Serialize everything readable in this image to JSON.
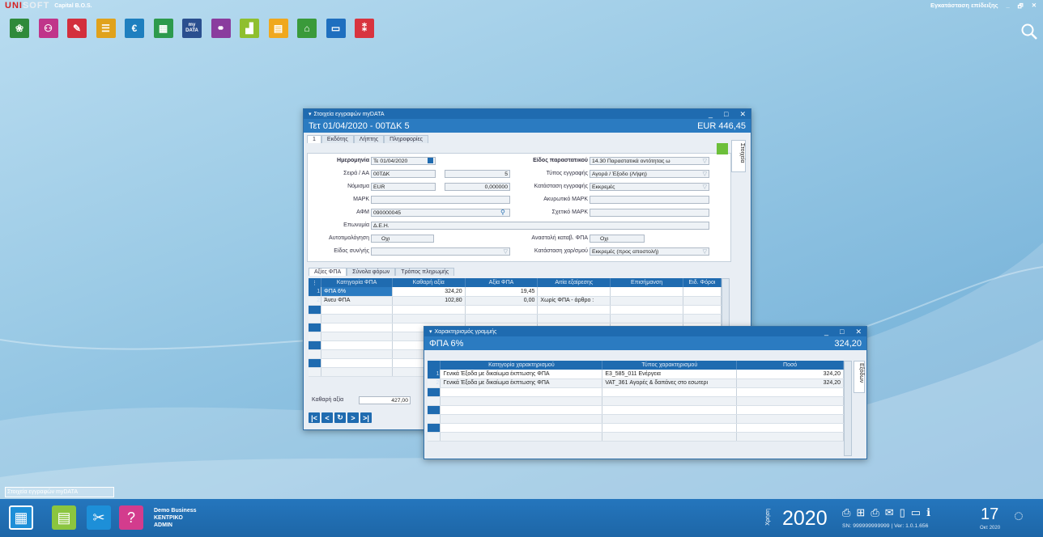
{
  "app": {
    "logo_red": "UNI",
    "logo_rest": "SOFT",
    "caption": "Capital B.O.S."
  },
  "top_right": {
    "install_label": "Εγκατάσταση επίδειξης",
    "min": "_",
    "restore": "🗗",
    "close": "✕"
  },
  "app_icons": [
    {
      "name": "app-1-icon",
      "color": "#2f8a3a",
      "glyph": "❀"
    },
    {
      "name": "app-2-icon",
      "color": "#c0358a",
      "glyph": "⚇"
    },
    {
      "name": "app-3-icon",
      "color": "#d32f3d",
      "glyph": "✎"
    },
    {
      "name": "app-4-icon",
      "color": "#e0a21c",
      "glyph": "☰"
    },
    {
      "name": "app-5-icon",
      "color": "#1e7fbf",
      "glyph": "€"
    },
    {
      "name": "app-6-icon",
      "color": "#2d9a4d",
      "glyph": "▦"
    },
    {
      "name": "app-7-icon",
      "color": "#2a4f8f",
      "glyph": "my DATA"
    },
    {
      "name": "app-8-icon",
      "color": "#8a3c9e",
      "glyph": "⚭"
    },
    {
      "name": "app-9-icon",
      "color": "#8fbf2f",
      "glyph": "▟"
    },
    {
      "name": "app-10-icon",
      "color": "#f0a81e",
      "glyph": "▤"
    },
    {
      "name": "app-11-icon",
      "color": "#3a9a3a",
      "glyph": "⌂"
    },
    {
      "name": "app-12-icon",
      "color": "#1e6fbf",
      "glyph": "▭"
    },
    {
      "name": "app-13-icon",
      "color": "#d8343f",
      "glyph": "⁑"
    }
  ],
  "doc_window": {
    "title": "Στοιχεία εγγραφών myDATA",
    "header_left": "Τετ 01/04/2020 - 00ΤΔΚ 5",
    "header_right": "EUR 446,45",
    "tabs": [
      "1",
      "Εκδότης",
      "Λήπτης",
      "Πληροφορίες"
    ],
    "side_tab": "Στοιχεία",
    "fields": {
      "date_label": "Ημερομηνία",
      "date_value": "Τε 01/04/2020",
      "series_label": "Σειρά / ΑΑ",
      "series_value": "00ΤΔΚ",
      "aa_value": "5",
      "currency_label": "Νόμισμα",
      "currency_value": "EUR",
      "rate_value": "0,000000",
      "mark_label": "ΜΑΡΚ",
      "mark_value": "",
      "afm_label": "ΑΦΜ",
      "afm_value": "090000045",
      "name_label": "Επωνυμία",
      "name_value": "Δ.Ε.Η.",
      "selfinv_label": "Αυτοτιμολόγηση",
      "selfinv_value": "Οχι",
      "kind_label": "Είδος συν/γής",
      "kind_value": "",
      "doctype_label": "Είδος παραστατικού",
      "doctype_value": "14.30 Παραστατικά οντότητας ω",
      "rectype_label": "Τύπος εγγραφής",
      "rectype_value": "Αγορά / Έξοδο (Λήψη)",
      "recstate_label": "Κατάσταση εγγραφής",
      "recstate_value": "Εκκρεμές",
      "cancelmark_label": "Ακυρωτικό ΜΑΡΚ",
      "cancelmark_value": "",
      "relmark_label": "Σχετικό ΜΑΡΚ",
      "relmark_value": "",
      "vatsusp_label": "Αναστολή καταβ. ΦΠΑ",
      "vatsusp_value": "Οχι",
      "charstate_label": "Κατάσταση χαρ/σμού",
      "charstate_value": "Εκκρεμές (προς αποστολή)"
    },
    "grid_tabs": [
      "Αξίες ΦΠΑ",
      "Σύνολα φόρων",
      "Τρόπος πληρωμής"
    ],
    "grid_columns": [
      "Κατηγορία ΦΠΑ",
      "Καθαρή αξία",
      "Αξία ΦΠΑ",
      "Αιτία εξαίρεσης",
      "Επισήμανση",
      "Ειδ. Φόροι"
    ],
    "grid_rows": [
      {
        "idx": "1",
        "cat": "ΦΠΑ 6%",
        "net": "324,20",
        "vat": "19,45",
        "reason": "",
        "note": "",
        "tax": ""
      },
      {
        "idx": "2",
        "cat": "Άνευ ΦΠΑ",
        "net": "102,80",
        "vat": "0,00",
        "reason": "Χωρίς ΦΠΑ - άρθρο :",
        "note": "",
        "tax": ""
      }
    ],
    "total_label": "Καθαρή αξία",
    "total_value": "427,00"
  },
  "char_window": {
    "title": "Χαρακτηρισμός γραμμής",
    "header_left": "ΦΠΑ 6%",
    "header_right": "324,20",
    "side_tab": "Εξόδων",
    "columns": [
      "Κατηγορία χαρακτηρισμού",
      "Τύπος χαρακτηρισμού",
      "Ποσό"
    ],
    "rows": [
      {
        "idx": "1",
        "cat": "Γενικά Έξοδα με δικαίωμα έκπτωσης ΦΠΑ",
        "type": "E3_585_011 Ενέργεια",
        "amount": "324,20"
      },
      {
        "idx": "2",
        "cat": "Γενικά Έξοδα με δικαίωμα έκπτωσης ΦΠΑ",
        "type": "VAT_361 Αγορές & δαπάνες στο εσωτερι",
        "amount": "324,20"
      }
    ]
  },
  "status_text": "Στοιχεία εγγραφών myDATA",
  "bottom": {
    "company": "Demo Business",
    "branch": "ΚΕΝΤΡΙΚΟ",
    "user": "ADMIN",
    "year_label": "Χρήση",
    "year": "2020",
    "serial": "SN: 999999999999 | Ver: 1.0.1.656",
    "day": "17",
    "month": "Οκτ 2020"
  }
}
